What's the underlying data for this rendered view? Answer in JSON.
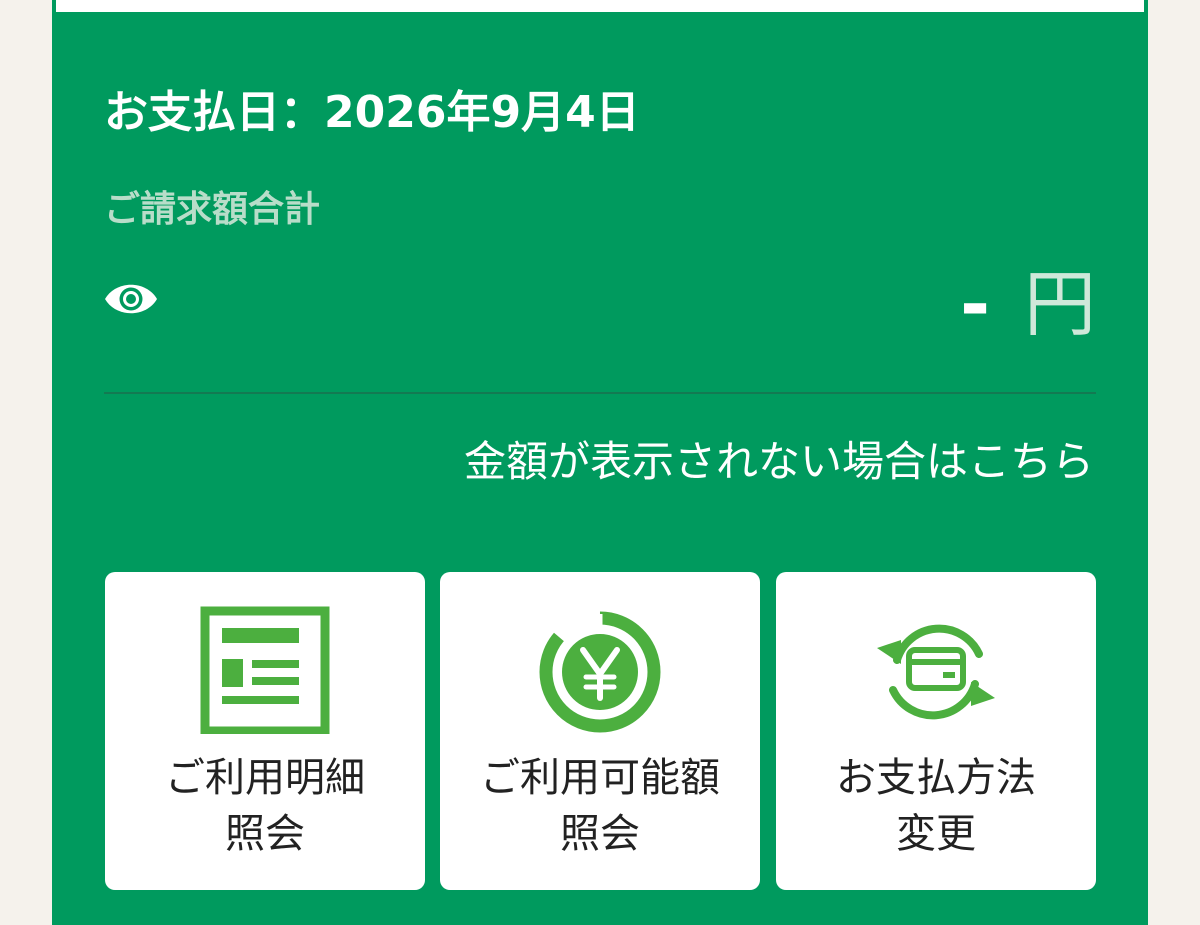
{
  "payment": {
    "date_label": "お支払日：2026年9月4日"
  },
  "billing": {
    "total_label": "ご請求額合計",
    "amount_value": "-",
    "amount_unit": "円",
    "toggle_icon": "eye-icon",
    "help_link": "金額が表示されない場合はこちら"
  },
  "tiles": [
    {
      "icon": "statement-icon",
      "line1": "ご利用明細",
      "line2": "照会"
    },
    {
      "icon": "yen-circle-icon",
      "line1": "ご利用可能額",
      "line2": "照会"
    },
    {
      "icon": "card-refresh-icon",
      "line1": "お支払方法",
      "line2": "変更"
    }
  ],
  "colors": {
    "primary_green": "#009a5e",
    "icon_green": "#4caf3f",
    "background": "#f5f2ec"
  }
}
